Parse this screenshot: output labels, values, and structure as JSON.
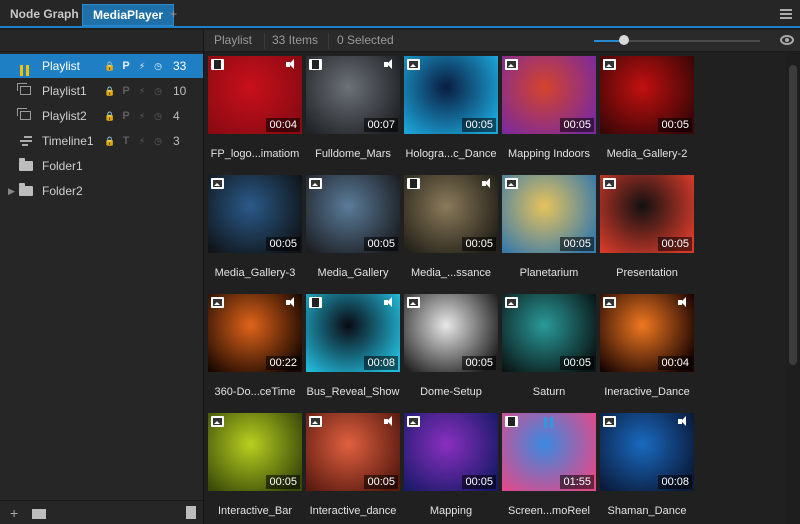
{
  "tabs": [
    {
      "label": "Node Graph",
      "active": false
    },
    {
      "label": "MediaPlayer",
      "active": true
    },
    {
      "label": "+",
      "active": false
    }
  ],
  "accent_color": "#1f7fc4",
  "tree": [
    {
      "label": "Playlist",
      "icon": "pause-icon",
      "flags": [
        "lock-icon",
        "P",
        "bolt-icon",
        "clock-icon"
      ],
      "count": "33",
      "active": true
    },
    {
      "label": "Playlist1",
      "icon": "playlist-icon",
      "flags": [
        "lock-icon",
        "P",
        "bolt-icon",
        "clock-icon"
      ],
      "count": "10",
      "active": false
    },
    {
      "label": "Playlist2",
      "icon": "playlist-icon",
      "flags": [
        "lock-icon",
        "P",
        "bolt-icon",
        "clock-icon"
      ],
      "count": "4",
      "active": false
    },
    {
      "label": "Timeline1",
      "icon": "timeline-icon",
      "flags": [
        "lock-icon",
        "T",
        "bolt-icon",
        "clock-icon"
      ],
      "count": "3",
      "active": false
    },
    {
      "label": "Folder1",
      "icon": "folder-icon",
      "flags": [],
      "count": "",
      "active": false
    },
    {
      "label": "Folder2",
      "icon": "folder-icon",
      "flags": [],
      "count": "",
      "active": false,
      "expandable": true
    }
  ],
  "toolbar": {
    "breadcrumb": "Playlist",
    "items_count": "33 Items",
    "selected_count": "0 Selected",
    "zoom_level": 0.18
  },
  "media": [
    {
      "name": "FP_logo...imatiom",
      "type": "video",
      "sound": true,
      "duration": "00:04",
      "bg": [
        "#c8101c",
        "#8a0a12"
      ]
    },
    {
      "name": "Fulldome_Mars",
      "type": "video",
      "sound": true,
      "duration": "00:07",
      "bg": [
        "#6c7178",
        "#1f2226"
      ]
    },
    {
      "name": "Hologra...c_Dance",
      "type": "image",
      "sound": false,
      "duration": "00:05",
      "bg": [
        "#0a1c40",
        "#1ba4d8"
      ]
    },
    {
      "name": "Mapping Indoors",
      "type": "image",
      "sound": false,
      "duration": "00:05",
      "bg": [
        "#d4442a",
        "#7c2a9c"
      ]
    },
    {
      "name": "Media_Gallery-2",
      "type": "image",
      "sound": false,
      "duration": "00:05",
      "bg": [
        "#c21010",
        "#3a0606"
      ]
    },
    {
      "name": "Media_Gallery-3",
      "type": "image",
      "sound": false,
      "duration": "00:05",
      "bg": [
        "#2a5a8a",
        "#101418"
      ]
    },
    {
      "name": "Media_Gallery",
      "type": "image",
      "sound": false,
      "duration": "00:05",
      "bg": [
        "#5a7c9a",
        "#1c1e22"
      ]
    },
    {
      "name": "Media_...ssance",
      "type": "video",
      "sound": true,
      "duration": "00:05",
      "bg": [
        "#8a7a5a",
        "#222018"
      ]
    },
    {
      "name": "Planetarium",
      "type": "image",
      "sound": false,
      "duration": "00:05",
      "bg": [
        "#e6c35c",
        "#3a7aa8"
      ]
    },
    {
      "name": "Presentation",
      "type": "image",
      "sound": false,
      "duration": "00:05",
      "bg": [
        "#111111",
        "#d43a2a"
      ]
    },
    {
      "name": "360-Do...ceTime",
      "type": "image",
      "sound": true,
      "duration": "00:22",
      "bg": [
        "#e0641a",
        "#1a0800"
      ]
    },
    {
      "name": "Bus_Reveal_Show",
      "type": "video",
      "sound": true,
      "duration": "00:08",
      "bg": [
        "#0a0a12",
        "#22b8d8"
      ]
    },
    {
      "name": "Dome-Setup",
      "type": "image",
      "sound": false,
      "duration": "00:05",
      "bg": [
        "#e8e8e8",
        "#202020"
      ]
    },
    {
      "name": "Saturn",
      "type": "image",
      "sound": false,
      "duration": "00:05",
      "bg": [
        "#2a9a9a",
        "#0a1616"
      ]
    },
    {
      "name": "Ineractive_Dance",
      "type": "image",
      "sound": true,
      "duration": "00:04",
      "bg": [
        "#f07820",
        "#1a0402"
      ]
    },
    {
      "name": "Interactive_Bar",
      "type": "image",
      "sound": false,
      "duration": "00:05",
      "bg": [
        "#b8d020",
        "#3a4a08"
      ]
    },
    {
      "name": "Interactive_dance",
      "type": "image",
      "sound": true,
      "duration": "00:05",
      "bg": [
        "#e06040",
        "#5a1a10"
      ]
    },
    {
      "name": "Mapping",
      "type": "image",
      "sound": false,
      "duration": "00:05",
      "bg": [
        "#8a30c0",
        "#1a1a6a"
      ]
    },
    {
      "name": "Screen...moReel",
      "type": "video",
      "sound": false,
      "duration": "01:55",
      "bg": [
        "#3a8ae0",
        "#e04a8a"
      ],
      "playing": true
    },
    {
      "name": "Shaman_Dance",
      "type": "image",
      "sound": true,
      "duration": "00:08",
      "bg": [
        "#1a6ac0",
        "#0a1a3a"
      ]
    }
  ]
}
